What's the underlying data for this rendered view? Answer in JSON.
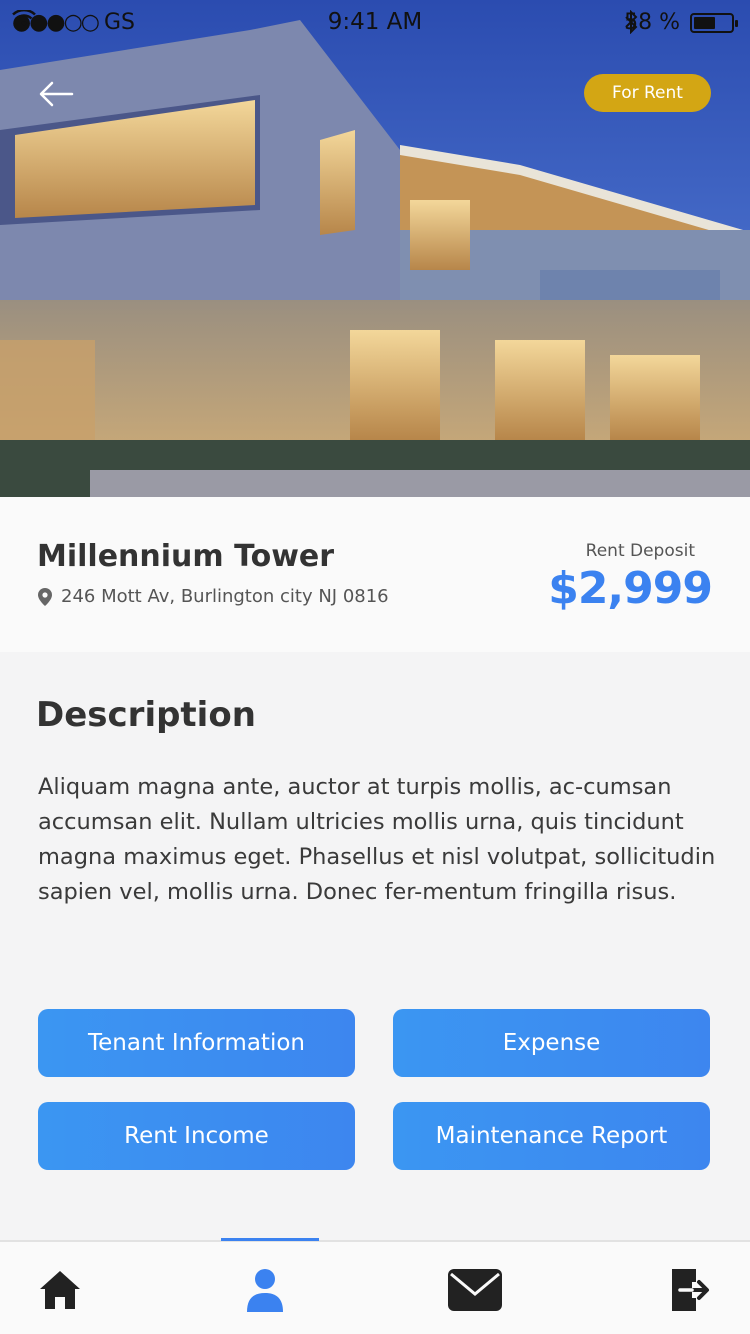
{
  "status_bar": {
    "signal": "●●●○○",
    "carrier": "GS",
    "time": "9:41 AM",
    "battery_percent": "58 %",
    "battery_level": 0.58
  },
  "hero": {
    "badge_label": "For Rent"
  },
  "property": {
    "name": "Millennium Tower",
    "address": "246 Mott Av, Burlington city NJ 0816",
    "deposit_label": "Rent Deposit",
    "price": "$2,999"
  },
  "description": {
    "heading": "Description",
    "text": "Aliquam magna ante, auctor at turpis mollis, ac-cumsan accumsan elit. Nullam ultricies mollis urna, quis tincidunt magna maximus eget. Phasellus et nisl volutpat, sollicitudin sapien vel, mollis urna. Donec fer-mentum fringilla risus."
  },
  "actions": {
    "tenant_info": "Tenant Information",
    "expense": "Expense",
    "rent_income": "Rent Income",
    "maintenance": "Maintenance Report"
  },
  "colors": {
    "accent": "#3b82f0",
    "badge": "#d3a614",
    "button": "#3d8cf1"
  },
  "nav": {
    "items": [
      "home-icon",
      "user-icon",
      "mail-icon",
      "logout-icon"
    ],
    "active": "user-icon"
  }
}
